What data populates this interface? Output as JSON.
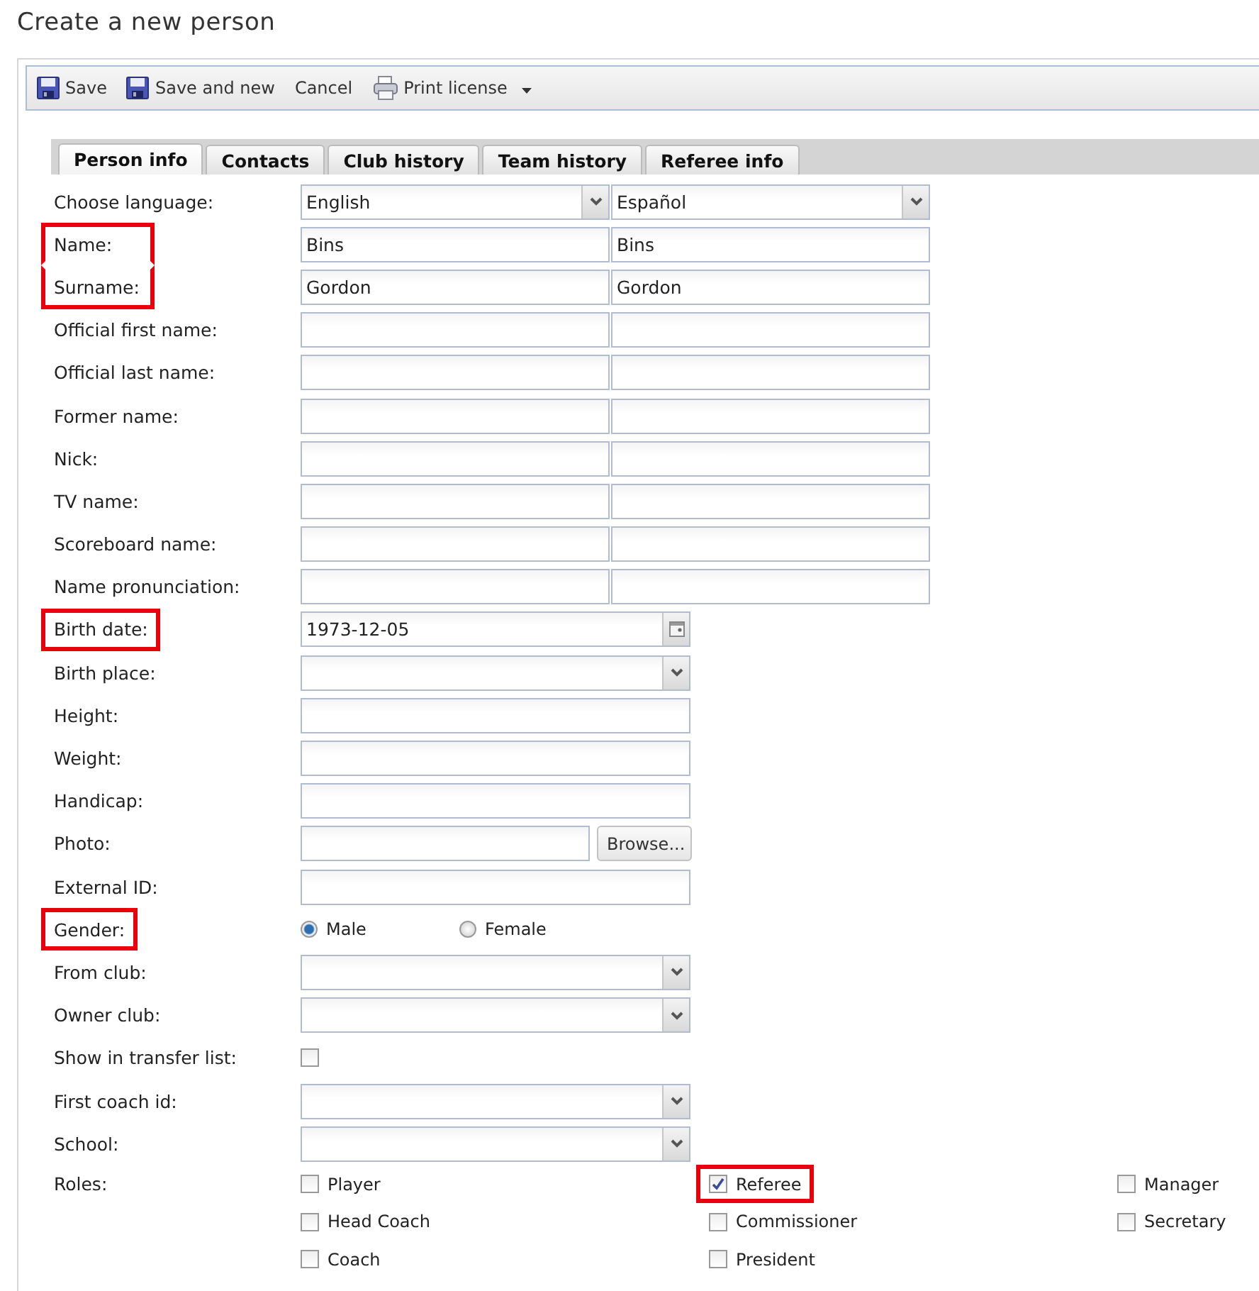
{
  "page_title": "Create a new person",
  "toolbar": [
    {
      "kind": "save",
      "label": "Save"
    },
    {
      "kind": "save",
      "label": "Save and new"
    },
    {
      "kind": "plain",
      "label": "Cancel"
    },
    {
      "kind": "print_menu",
      "label": "Print license"
    }
  ],
  "tabs": [
    {
      "label": "Person info",
      "selected": true
    },
    {
      "label": "Contacts",
      "selected": false
    },
    {
      "label": "Club history",
      "selected": false
    },
    {
      "label": "Team history",
      "selected": false
    },
    {
      "label": "Referee info",
      "selected": false
    }
  ],
  "rows": [
    {
      "kind": "select_pair",
      "label": "Choose language:",
      "highlighted": false,
      "values": [
        "English",
        "Español"
      ]
    },
    {
      "kind": "text_pair",
      "label": "Name:",
      "highlighted": true,
      "values": [
        "Bins",
        "Bins"
      ]
    },
    {
      "kind": "text_pair",
      "label": "Surname:",
      "highlighted": true,
      "values": [
        "Gordon",
        "Gordon"
      ]
    },
    {
      "kind": "text_pair",
      "label": "Official first name:",
      "highlighted": false
    },
    {
      "kind": "text_pair",
      "label": "Official last name:",
      "highlighted": false
    },
    {
      "kind": "text_pair",
      "label": "Former name:",
      "highlighted": false
    },
    {
      "kind": "text_pair",
      "label": "Nick:",
      "highlighted": false
    },
    {
      "kind": "text_pair",
      "label": "TV name:",
      "highlighted": false
    },
    {
      "kind": "text_pair",
      "label": "Scoreboard name:",
      "highlighted": false
    },
    {
      "kind": "text_pair",
      "label": "Name pronunciation:",
      "highlighted": false
    },
    {
      "kind": "date",
      "label": "Birth date:",
      "highlighted": true,
      "value": "1973-12-05"
    },
    {
      "kind": "select",
      "label": "Birth place:",
      "highlighted": false
    },
    {
      "kind": "text",
      "label": "Height:",
      "highlighted": false
    },
    {
      "kind": "text",
      "label": "Weight:",
      "highlighted": false
    },
    {
      "kind": "text",
      "label": "Handicap:",
      "highlighted": false
    },
    {
      "kind": "file",
      "label": "Photo:",
      "highlighted": false,
      "button": "Browse..."
    },
    {
      "kind": "text",
      "label": "External ID:",
      "highlighted": false
    },
    {
      "kind": "radio",
      "label": "Gender:",
      "highlighted": true,
      "options": [
        {
          "label": "Male",
          "selected": true
        },
        {
          "label": "Female",
          "selected": false
        }
      ]
    },
    {
      "kind": "select",
      "label": "From club:",
      "highlighted": false
    },
    {
      "kind": "select",
      "label": "Owner club:",
      "highlighted": false
    },
    {
      "kind": "checkbox",
      "label": "Show in transfer list:",
      "highlighted": false,
      "checked": false
    },
    {
      "kind": "select",
      "label": "First coach id:",
      "highlighted": false
    },
    {
      "kind": "select",
      "label": "School:",
      "highlighted": false
    }
  ],
  "roles": {
    "label": "Roles:",
    "columns": [
      [
        {
          "label": "Player",
          "checked": false,
          "highlighted": false
        },
        {
          "label": "Head Coach",
          "checked": false,
          "highlighted": false
        },
        {
          "label": "Coach",
          "checked": false,
          "highlighted": false
        }
      ],
      [
        {
          "label": "Referee",
          "checked": true,
          "highlighted": true
        },
        {
          "label": "Commissioner",
          "checked": false,
          "highlighted": false
        },
        {
          "label": "President",
          "checked": false,
          "highlighted": false
        }
      ],
      [
        {
          "label": "Manager",
          "checked": false,
          "highlighted": false
        },
        {
          "label": "Secretary",
          "checked": false,
          "highlighted": false
        }
      ]
    ]
  }
}
